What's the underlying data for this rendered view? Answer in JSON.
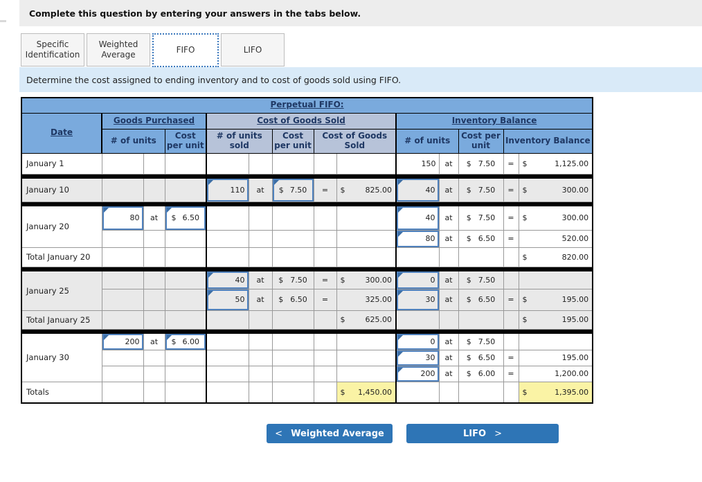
{
  "banner": {
    "text": "Complete this question by entering your answers in the tabs below."
  },
  "tabs": [
    {
      "label": "Specific Identification",
      "active": false
    },
    {
      "label": "Weighted Average",
      "active": false
    },
    {
      "label": "FIFO",
      "active": true
    },
    {
      "label": "LIFO",
      "active": false
    }
  ],
  "instruction": "Determine the cost assigned to ending inventory and to cost of goods sold using FIFO.",
  "table": {
    "title": "Perpetual FIFO:",
    "headers": {
      "date": "Date",
      "purchased": "Goods Purchased",
      "cogs": "Cost of Goods Sold",
      "inventory": "Inventory Balance",
      "gp_units": "# of units",
      "gp_cost": "Cost per unit",
      "cogs_units": "# of units sold",
      "cogs_cost": "Cost per unit",
      "cogs_value": "Cost of Goods Sold",
      "inv_units": "# of units",
      "inv_cost": "Cost per unit",
      "inv_value": "Inventory Balance"
    }
  },
  "sym": {
    "at": "at",
    "eq": "=",
    "cur": "$"
  },
  "rows": {
    "jan1": {
      "date": "January 1",
      "inv_units": "150",
      "inv_cost": "7.50",
      "inv_val": "1,125.00"
    },
    "jan10": {
      "date": "January 10",
      "cogs_units": "110",
      "cogs_cost": "7.50",
      "cogs_val": "825.00",
      "inv_units": "40",
      "inv_cost": "7.50",
      "inv_val": "300.00"
    },
    "jan20a": {
      "date": "January 20",
      "gp_units": "80",
      "gp_cost": "6.50",
      "inv_units": "40",
      "inv_cost": "7.50",
      "inv_val": "300.00"
    },
    "jan20b": {
      "inv_units": "80",
      "inv_cost": "6.50",
      "inv_val": "520.00"
    },
    "jan20t": {
      "date": "Total January 20",
      "inv_val": "820.00"
    },
    "jan25a": {
      "date": "January 25",
      "cogs_units": "40",
      "cogs_cost": "7.50",
      "cogs_val": "300.00",
      "inv_units": "0",
      "inv_cost": "7.50"
    },
    "jan25b": {
      "cogs_units": "50",
      "cogs_cost": "6.50",
      "cogs_val": "325.00",
      "inv_units": "30",
      "inv_cost": "6.50",
      "inv_val": "195.00"
    },
    "jan25t": {
      "date": "Total January 25",
      "cogs_val": "625.00",
      "inv_val": "195.00"
    },
    "jan30a": {
      "date": "January 30",
      "gp_units": "200",
      "gp_cost": "6.00",
      "inv_units": "0",
      "inv_cost": "7.50"
    },
    "jan30b": {
      "inv_units": "30",
      "inv_cost": "6.50",
      "inv_val": "195.00"
    },
    "jan30c": {
      "inv_units": "200",
      "inv_cost": "6.00",
      "inv_val": "1,200.00"
    },
    "totals": {
      "date": "Totals",
      "cogs_val": "1,450.00",
      "inv_val": "1,395.00"
    }
  },
  "buttons": {
    "prev": {
      "icon": "<",
      "label": "Weighted Average"
    },
    "next": {
      "label": "LIFO",
      "icon": ">"
    }
  },
  "colors": {
    "header_blue": "#7aaadd",
    "cogs_header_blue_gray": "#b7c3d9",
    "header_text_navy": "#1f3864",
    "row_gray": "#e9e9e9",
    "highlight_yellow": "#faf3a5",
    "button_blue": "#2e75b6",
    "input_border_blue": "#4f81bd",
    "instruction_bar_blue": "#d9eaf8"
  }
}
